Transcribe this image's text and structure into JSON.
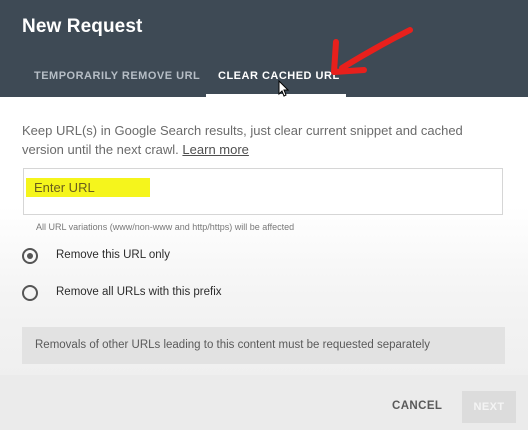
{
  "dialog": {
    "title": "New Request",
    "tabs": [
      {
        "label": "TEMPORARILY REMOVE URL",
        "active": false
      },
      {
        "label": "CLEAR CACHED URL",
        "active": true
      }
    ],
    "description": "Keep URL(s) in Google Search results, just clear current snippet and cached version until the next crawl.",
    "learn_more": "Learn more",
    "url_input": {
      "placeholder": "Enter URL",
      "value": ""
    },
    "hint": "All URL variations (www/non-www and http/https) will be affected",
    "options": [
      {
        "label": "Remove this URL only",
        "selected": true
      },
      {
        "label": "Remove all URLs with this prefix",
        "selected": false
      }
    ],
    "notice": "Removals of other URLs leading to this content must be requested separately",
    "buttons": {
      "cancel": "CANCEL",
      "next": "NEXT"
    }
  },
  "colors": {
    "header_bg": "#3e4a55",
    "annotation_arrow": "#e8201c",
    "highlight": "#f5f51c"
  }
}
